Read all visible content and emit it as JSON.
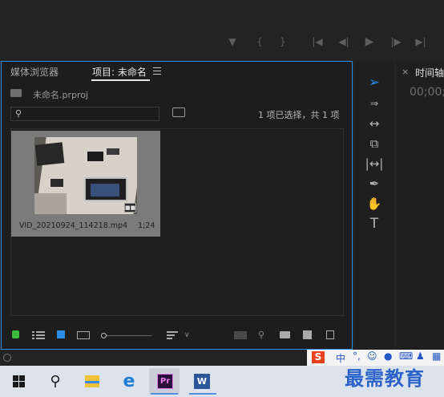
{
  "project_panel": {
    "tabs": [
      "媒体浏览器",
      "项目: 未命名"
    ],
    "menu_icon": "hamburger-icon",
    "project_file": "未命名.prproj",
    "search": {
      "placeholder": "",
      "value": ""
    },
    "selection_status": "1 项已选择，共 1 项",
    "items": [
      {
        "name": "VID_20210924_114218.mp4",
        "duration": "1;24"
      }
    ]
  },
  "timeline": {
    "title": "时间轴",
    "timecode": "00;00;"
  },
  "watermark": "最需教育",
  "ime": {
    "logo": "S",
    "lang": "中"
  },
  "colors": {
    "accent": "#2d8ceb",
    "selection_tool": "#2d8ceb",
    "premiere": "#2a0e3b"
  }
}
